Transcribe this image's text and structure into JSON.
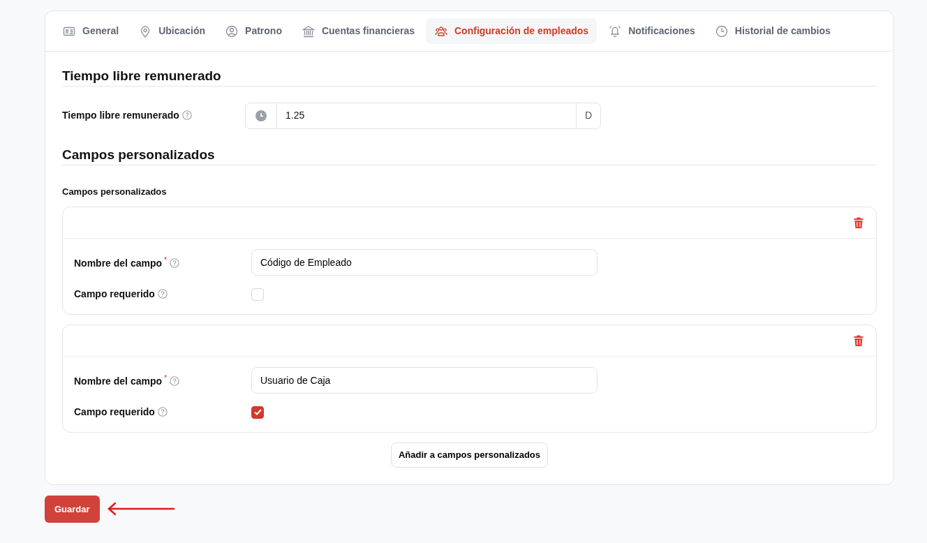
{
  "tabs": [
    {
      "label": "General",
      "selected": false
    },
    {
      "label": "Ubicación",
      "selected": false
    },
    {
      "label": "Patrono",
      "selected": false
    },
    {
      "label": "Cuentas financieras",
      "selected": false
    },
    {
      "label": "Configuración de empleados",
      "selected": true
    },
    {
      "label": "Notificaciones",
      "selected": false
    },
    {
      "label": "Historial de cambios",
      "selected": false
    }
  ],
  "pto": {
    "heading": "Tiempo libre remunerado",
    "label": "Tiempo libre remunerado",
    "value": "1.25",
    "suffix": "D"
  },
  "custom": {
    "heading": "Campos personalizados",
    "label": "Campos personalizados",
    "items": [
      {
        "name_label": "Nombre del campo",
        "required_mark": "*",
        "name_value": "Código de Empleado",
        "required_label": "Campo requerido",
        "checked": false
      },
      {
        "name_label": "Nombre del campo",
        "required_mark": "*",
        "name_value": "Usuario de Caja",
        "required_label": "Campo requerido",
        "checked": true
      }
    ],
    "add_button": "Añadir a campos personalizados"
  },
  "save_button": "Guardar"
}
